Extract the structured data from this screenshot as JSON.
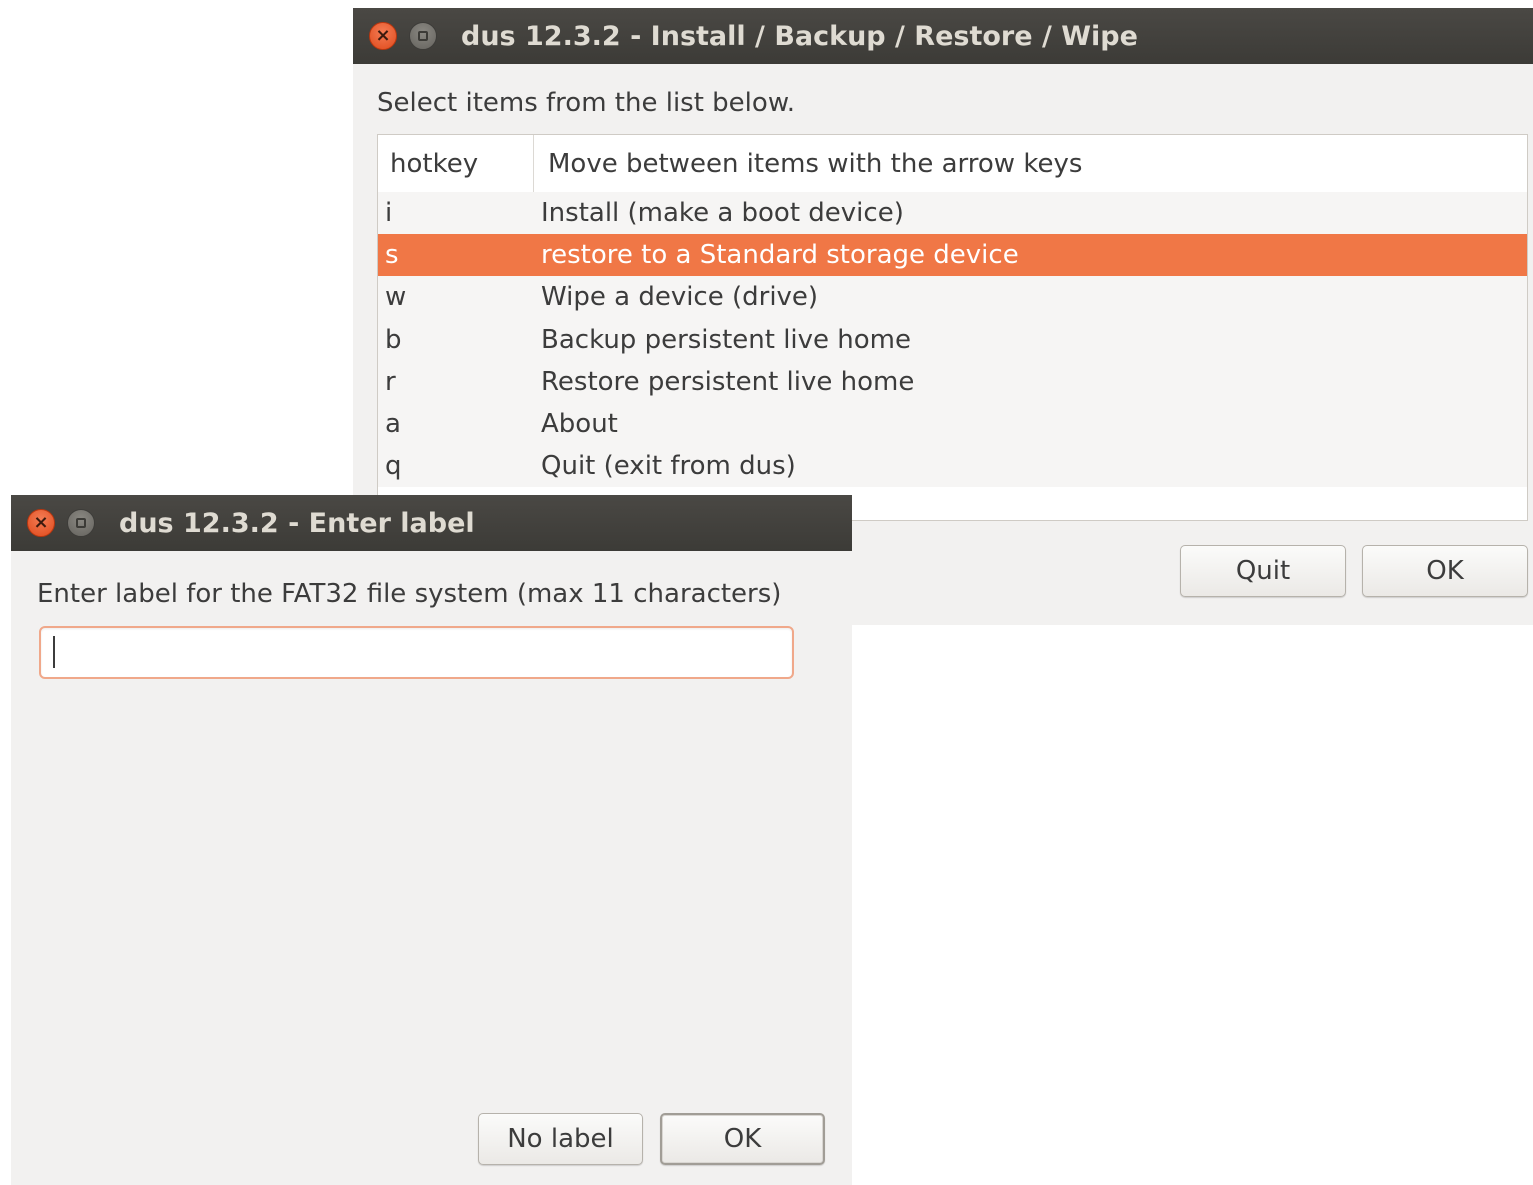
{
  "main_window": {
    "title": "dus 12.3.2 - Install / Backup / Restore / Wipe",
    "prompt": "Select items from the list below.",
    "columns": {
      "hotkey": "hotkey",
      "description": "Move between items with the arrow keys"
    },
    "items": [
      {
        "key": "i",
        "label": "Install (make a boot device)"
      },
      {
        "key": "s",
        "label": "restore to a Standard storage device",
        "selected": true
      },
      {
        "key": "w",
        "label": "Wipe a device (drive)"
      },
      {
        "key": "b",
        "label": "Backup persistent live home"
      },
      {
        "key": "r",
        "label": "Restore persistent live home"
      },
      {
        "key": "a",
        "label": "About"
      },
      {
        "key": "q",
        "label": "Quit (exit from dus)"
      }
    ],
    "buttons": {
      "quit": "Quit",
      "ok": "OK"
    }
  },
  "label_dialog": {
    "title": "dus 12.3.2 - Enter label",
    "prompt": "Enter label for the FAT32 file system (max 11 characters)",
    "input_value": "",
    "buttons": {
      "no_label": "No label",
      "ok": "OK"
    }
  },
  "icons": {
    "close": "close-icon",
    "maximize": "maximize-icon"
  },
  "colors": {
    "selection": "#f07746",
    "titlebar": "#3c3b37",
    "window_bg": "#f2f1f0",
    "focus_border": "#f0a88a"
  }
}
